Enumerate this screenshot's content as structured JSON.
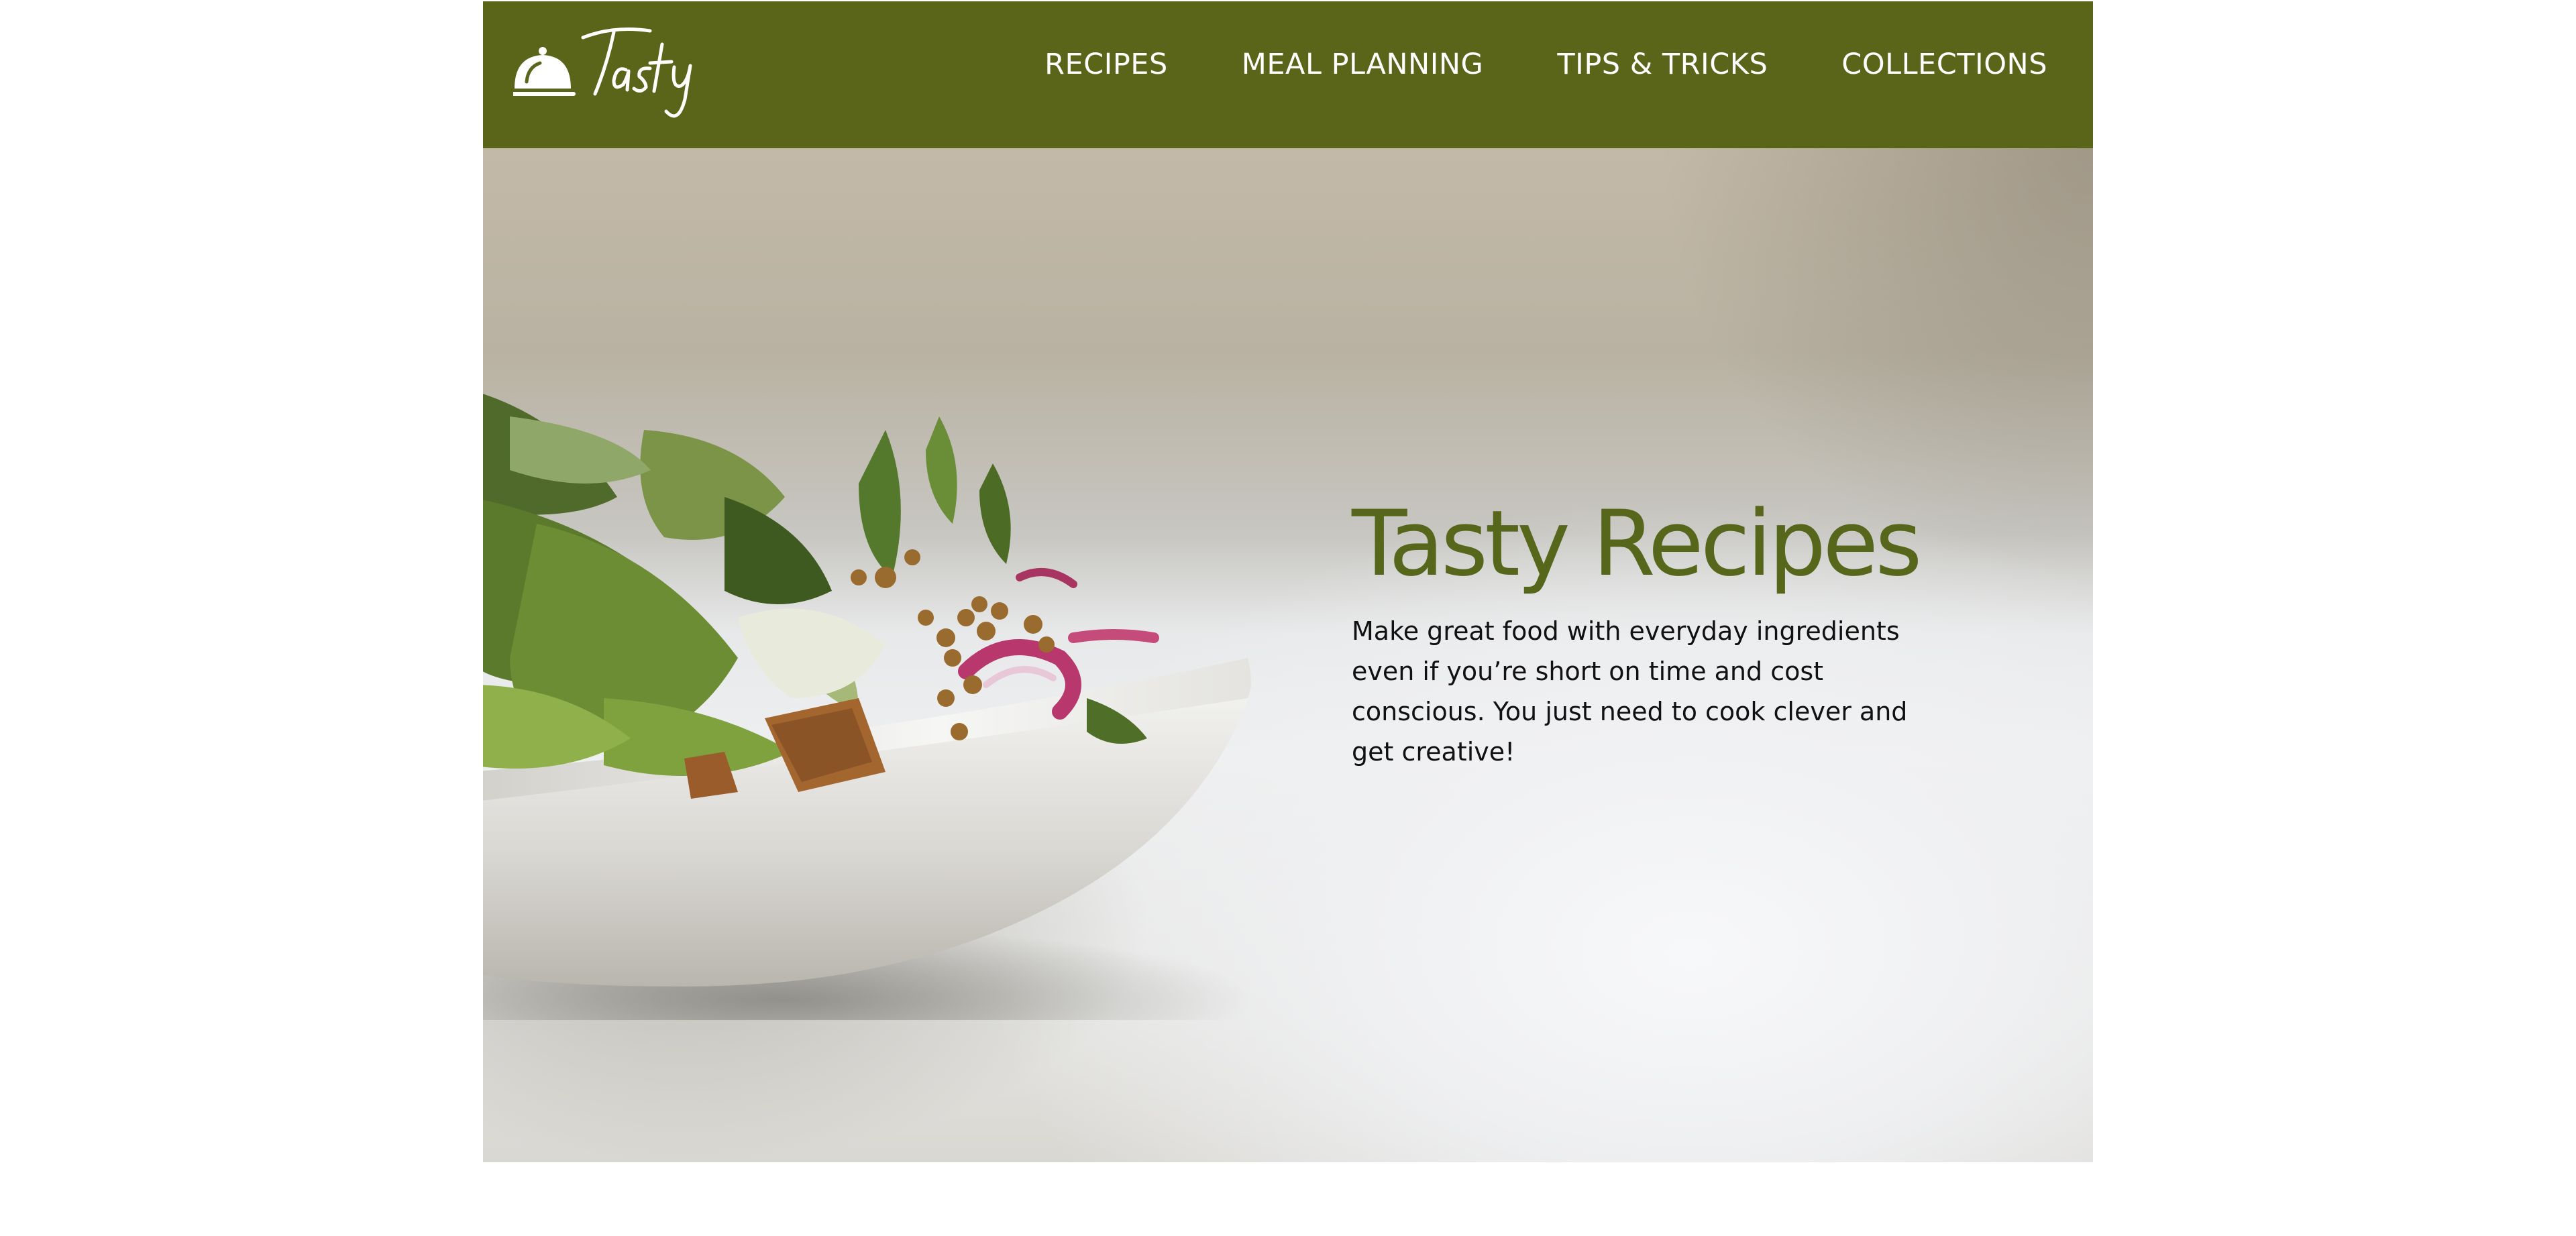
{
  "header": {
    "logo_text": "Tasty",
    "logo_icon": "cloche-icon",
    "nav": [
      {
        "label": "RECIPES"
      },
      {
        "label": "MEAL PLANNING"
      },
      {
        "label": "TIPS & TRICKS"
      },
      {
        "label": "COLLECTIONS"
      }
    ]
  },
  "hero": {
    "title": "Tasty Recipes",
    "description": "Make great food with everyday ingredients even if you’re short on time and cost conscious. You just need to cook clever and get creative!",
    "image": "salad-bowl-photo"
  },
  "colors": {
    "brand": "#5a6519",
    "title": "#56661a",
    "nav_text": "#ffffff"
  }
}
